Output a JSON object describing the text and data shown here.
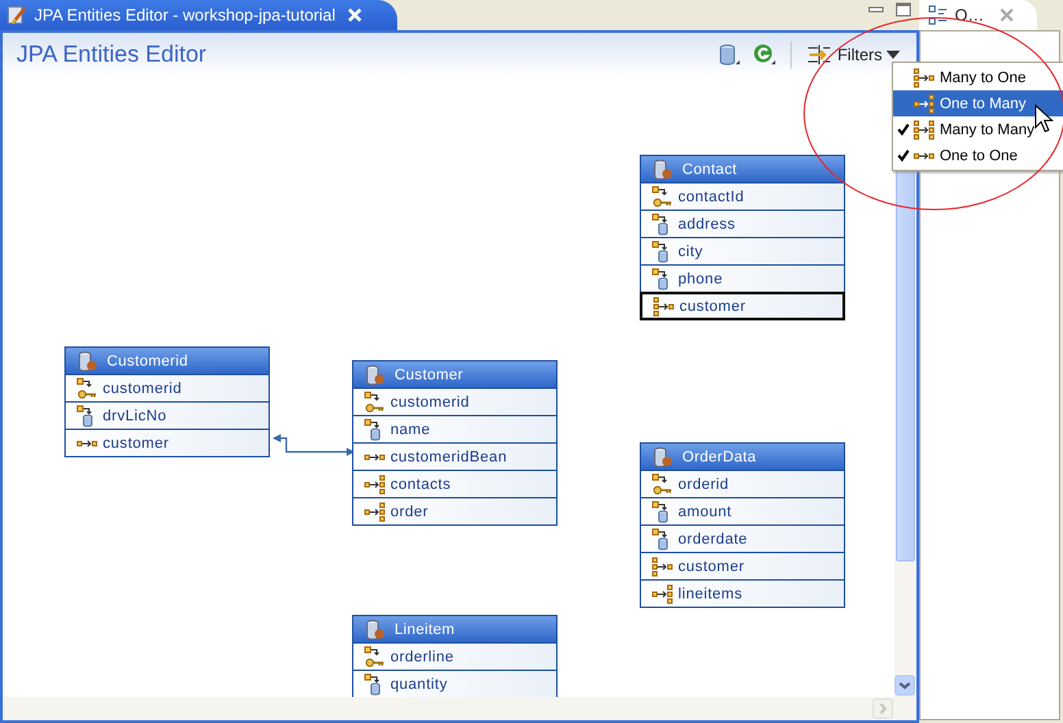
{
  "editor_tab": {
    "title": "JPA Entities Editor - workshop-jpa-tutorial"
  },
  "editor": {
    "title": "JPA Entities Editor",
    "filters_button": "Filters"
  },
  "side_view": {
    "tab_title": "O…"
  },
  "filter_menu": [
    {
      "label": "Many to One",
      "kind": "many_to_one",
      "checked": false,
      "selected": false
    },
    {
      "label": "One to Many",
      "kind": "one_to_many",
      "checked": false,
      "selected": true
    },
    {
      "label": "Many to Many",
      "kind": "many_to_many",
      "checked": true,
      "selected": false
    },
    {
      "label": "One to One",
      "kind": "one_to_one",
      "checked": true,
      "selected": false
    }
  ],
  "entities": [
    {
      "name": "Contact",
      "fields": [
        {
          "name": "contactId",
          "kind": "id",
          "selected": false
        },
        {
          "name": "address",
          "kind": "basic",
          "selected": false
        },
        {
          "name": "city",
          "kind": "basic",
          "selected": false
        },
        {
          "name": "phone",
          "kind": "basic",
          "selected": false
        },
        {
          "name": "customer",
          "kind": "many_to_one",
          "selected": true
        }
      ]
    },
    {
      "name": "Customerid",
      "fields": [
        {
          "name": "customerid",
          "kind": "id",
          "selected": false
        },
        {
          "name": "drvLicNo",
          "kind": "basic",
          "selected": false
        },
        {
          "name": "customer",
          "kind": "one_to_one",
          "selected": false
        }
      ]
    },
    {
      "name": "Customer",
      "fields": [
        {
          "name": "customerid",
          "kind": "id",
          "selected": false
        },
        {
          "name": "name",
          "kind": "basic",
          "selected": false
        },
        {
          "name": "customeridBean",
          "kind": "one_to_one",
          "selected": false
        },
        {
          "name": "contacts",
          "kind": "one_to_many",
          "selected": false
        },
        {
          "name": "order",
          "kind": "one_to_many",
          "selected": false
        }
      ]
    },
    {
      "name": "OrderData",
      "fields": [
        {
          "name": "orderid",
          "kind": "id",
          "selected": false
        },
        {
          "name": "amount",
          "kind": "basic",
          "selected": false
        },
        {
          "name": "orderdate",
          "kind": "basic",
          "selected": false
        },
        {
          "name": "customer",
          "kind": "many_to_one",
          "selected": false
        },
        {
          "name": "lineitems",
          "kind": "one_to_many",
          "selected": false
        }
      ]
    },
    {
      "name": "Lineitem",
      "fields": [
        {
          "name": "orderline",
          "kind": "id",
          "selected": false
        },
        {
          "name": "quantity",
          "kind": "basic",
          "selected": false
        }
      ]
    }
  ]
}
